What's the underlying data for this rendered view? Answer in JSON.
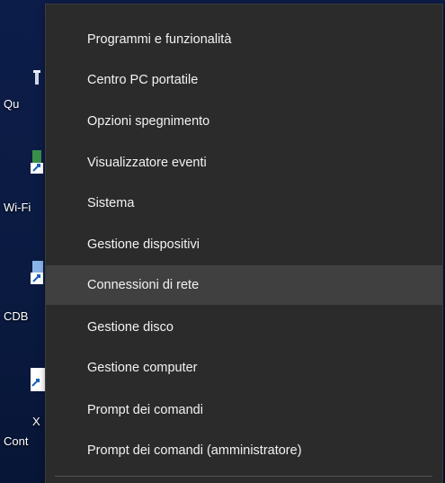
{
  "desktop": {
    "icons": [
      {
        "label": "Qu",
        "icon": "recycle-bin-icon"
      },
      {
        "label": "Wi-Fi",
        "icon": "shortcut-icon"
      },
      {
        "label": "CDB",
        "icon": "shortcut-icon"
      },
      {
        "label": "X",
        "icon": "document-shortcut-icon"
      },
      {
        "label": "Cont",
        "icon": "document-shortcut-icon"
      }
    ]
  },
  "menu": {
    "items": [
      {
        "label": "Programmi e funzionalità"
      },
      {
        "label": "Centro PC portatile"
      },
      {
        "label": "Opzioni spegnimento"
      },
      {
        "label": "Visualizzatore eventi"
      },
      {
        "label": "Sistema"
      },
      {
        "label": "Gestione dispositivi"
      },
      {
        "label": "Connessioni di rete"
      },
      {
        "label": "Gestione disco"
      },
      {
        "label": "Gestione computer"
      },
      {
        "label": "Prompt dei comandi"
      },
      {
        "label": "Prompt dei comandi (amministratore)"
      }
    ],
    "hovered_item": "Connessioni di rete"
  },
  "colors": {
    "menu_background": "#2b2b2b",
    "menu_hover": "#404040",
    "menu_text": "#f2f2f2",
    "desktop_background": "#0b1b44"
  }
}
